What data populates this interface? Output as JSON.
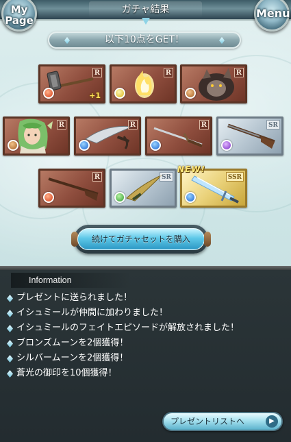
{
  "header": {
    "title": "ガチャ結果",
    "mypage_label": "My Page",
    "menu_label": "Menu"
  },
  "banner": {
    "text": "以下10点をGET！"
  },
  "items": [
    {
      "rarity": "R",
      "element": "fire",
      "icon": "hammer-icon",
      "bonus": "+1"
    },
    {
      "rarity": "R",
      "element": "light",
      "icon": "flame-spirit-icon"
    },
    {
      "rarity": "R",
      "element": "earth",
      "icon": "beast-icon"
    },
    {
      "rarity": "R",
      "element": "earth",
      "icon": "character-portrait-icon"
    },
    {
      "rarity": "R",
      "element": "water",
      "icon": "curved-blade-icon"
    },
    {
      "rarity": "R",
      "element": "fire",
      "icon": "rapier-icon"
    },
    {
      "rarity": "SR",
      "element": "dark",
      "icon": "rifle-icon"
    },
    {
      "rarity": "R",
      "element": "fire",
      "icon": "musket-icon"
    },
    {
      "rarity": "SR",
      "element": "wind",
      "icon": "dagger-icon"
    },
    {
      "rarity": "SSR",
      "element": "water",
      "icon": "ice-sword-icon",
      "badge": "NEW!"
    }
  ],
  "buy_button": {
    "label": "続けてガチャセットを購入"
  },
  "info": {
    "tab_label": "Information",
    "messages": [
      "プレゼントに送られました！",
      "イシュミールが仲間に加わりました！",
      "イシュミールのフェイトエピソードが解放されました！",
      "ブロンズムーンを2個獲得！",
      "シルバームーンを2個獲得！",
      "蒼光の御印を10個獲得！"
    ]
  },
  "present_button": {
    "label": "プレゼントリストへ"
  },
  "colors": {
    "accent": "#5ec8e8",
    "r_card": "#8f4e3e",
    "sr_card": "#b8c7d2",
    "ssr_card": "#ead27a",
    "panel": "#2b3538"
  }
}
